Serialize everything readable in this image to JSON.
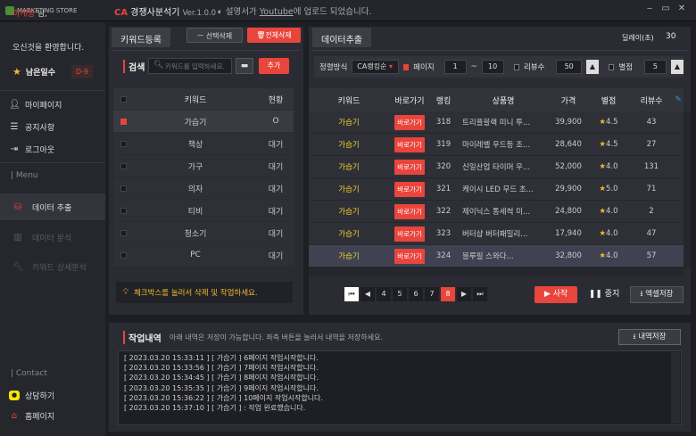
{
  "titlebar": {
    "logo_text": "MARKETING STORE",
    "app_prefix": "CA",
    "app_name": "경쟁사분석기",
    "version": "Ver.1.0.0",
    "notice_prefix": "설명서가",
    "notice_link": "Youtube",
    "notice_suffix": "에 업로드 되었습니다.",
    "min": "‒",
    "max": "▭",
    "close": "✕"
  },
  "sidebar": {
    "user_name": "마케팅",
    "user_suffix": " 님,",
    "welcome": "오신것을 환영합니다.",
    "days_label": "남은일수",
    "days_value": "D-9",
    "nav": [
      {
        "label": "마이페이지"
      },
      {
        "label": "공지사항"
      },
      {
        "label": "로그아웃"
      }
    ],
    "menu_section": "| Menu",
    "menu": [
      {
        "label": "데이터 추출"
      },
      {
        "label": "데이터 분석"
      },
      {
        "label": "키워드 상세분석"
      }
    ],
    "contact_section": "| Contact",
    "contact": [
      {
        "label": "상담하기"
      },
      {
        "label": "홈페이지"
      }
    ]
  },
  "keyword_panel": {
    "tab": "키워드등록",
    "delete_selected": "ㅡ 선택삭제",
    "delete_all": "전체삭제",
    "search_label": "검색",
    "search_placeholder": "키워드를 입력하세요.",
    "add_button": "추가",
    "columns": [
      "키워드",
      "현황"
    ],
    "rows": [
      {
        "keyword": "가습기",
        "status": "O",
        "checked": true
      },
      {
        "keyword": "책상",
        "status": "대기",
        "checked": false
      },
      {
        "keyword": "가구",
        "status": "대기",
        "checked": false
      },
      {
        "keyword": "의자",
        "status": "대기",
        "checked": false
      },
      {
        "keyword": "티비",
        "status": "대기",
        "checked": false
      },
      {
        "keyword": "청소기",
        "status": "대기",
        "checked": false
      },
      {
        "keyword": "PC",
        "status": "대기",
        "checked": false
      }
    ],
    "hint": "체크박스를 눌러서 삭제 및 작업하세요."
  },
  "data_panel": {
    "tab": "데이터추출",
    "delay_label": "딜레이(초)",
    "delay_value": "30",
    "sort_label": "정렬방식",
    "sort_value": "CA랭킹순",
    "page_label": "페이지",
    "page_from": "1",
    "page_sep": "~",
    "page_to": "10",
    "review_label": "리뷰수",
    "review_value": "50",
    "rating_label": "별점",
    "rating_value": "5",
    "columns": [
      "키워드",
      "바로가기",
      "랭킹",
      "상품명",
      "가격",
      "별점",
      "리뷰수"
    ],
    "go_label": "바로가기",
    "rows": [
      {
        "keyword": "가습기",
        "rank": "318",
        "name": "트리플블랙 미니 투...",
        "price": "39,900",
        "rating": "4.5",
        "reviews": "43"
      },
      {
        "keyword": "가습기",
        "rank": "319",
        "name": "마이레벨 우드등 조...",
        "price": "28,640",
        "rating": "4.5",
        "reviews": "27"
      },
      {
        "keyword": "가습기",
        "rank": "320",
        "name": "신일산업 타이머 우...",
        "price": "52,000",
        "rating": "4.0",
        "reviews": "131"
      },
      {
        "keyword": "가습기",
        "rank": "321",
        "name": "케이시 LED 무드 초...",
        "price": "29,900",
        "rating": "5.0",
        "reviews": "71"
      },
      {
        "keyword": "가습기",
        "rank": "322",
        "name": "제이닉스 통세척 미...",
        "price": "24,800",
        "rating": "4.0",
        "reviews": "2"
      },
      {
        "keyword": "가습기",
        "rank": "323",
        "name": "버터샵 버터패밀리...",
        "price": "17,940",
        "rating": "4.0",
        "reviews": "47"
      },
      {
        "keyword": "가습기",
        "rank": "324",
        "name": "블루필 스와다...",
        "price": "32,800",
        "rating": "4.0",
        "reviews": "57"
      }
    ],
    "pages": [
      "4",
      "5",
      "6",
      "7",
      "8"
    ],
    "current_page": "8",
    "start": "사작",
    "stop": "중지",
    "excel": "엑셀저장"
  },
  "log_panel": {
    "title": "작업내역",
    "desc": "아래 내역은 저장이 가능합니다. 좌측 버튼을 눌러서 내역을 저장하세요.",
    "save": "내역저장",
    "lines": [
      "[ 2023.03.20 15:33:11 ] [ 가습기 ] 6페이지 작업시작합니다.",
      "[ 2023.03.20 15:33:56 ] [ 가습기 ] 7페이지 작업시작합니다.",
      "[ 2023.03.20 15:34:45 ] [ 가습기 ] 8페이지 작업시작합니다.",
      "[ 2023.03.20 15:35:35 ] [ 가습기 ] 9페이지 작업시작합니다.",
      "[ 2023.03.20 15:36:22 ] [ 가습기 ] 10페이지 작업시작합니다.",
      "[ 2023.03.20 15:37:10 ] [ 가습기 ] : 작업 완료했습니다."
    ]
  }
}
